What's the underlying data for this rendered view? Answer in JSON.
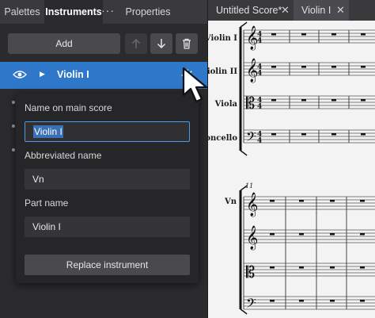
{
  "panel_tabs": {
    "palettes": "Palettes",
    "instruments": "Instruments",
    "more": "···",
    "properties": "Properties"
  },
  "toolbar": {
    "add_label": "Add"
  },
  "instrument": {
    "name": "Violin I",
    "expand_glyph": "▶"
  },
  "popup": {
    "main_score_label": "Name on main score",
    "main_score_value": "Violin I",
    "abbrev_label": "Abbreviated name",
    "abbrev_value": "Vn",
    "part_label": "Part name",
    "part_value": "Violin I",
    "replace_label": "Replace instrument"
  },
  "doc_tabs": {
    "score_tab": "Untitled Score*",
    "part_tab": "Violin I",
    "close_glyph": "✕"
  },
  "score": {
    "staff_names": [
      "Violin I",
      "Violin II",
      "Viola",
      "Violoncello"
    ],
    "time_signature": [
      "4",
      "4"
    ],
    "system2_label": "Vn",
    "system2_measure_number": "11",
    "rest_glyph": "▬"
  },
  "colors": {
    "accent": "#2f78c9",
    "focus": "#4a9be8"
  }
}
